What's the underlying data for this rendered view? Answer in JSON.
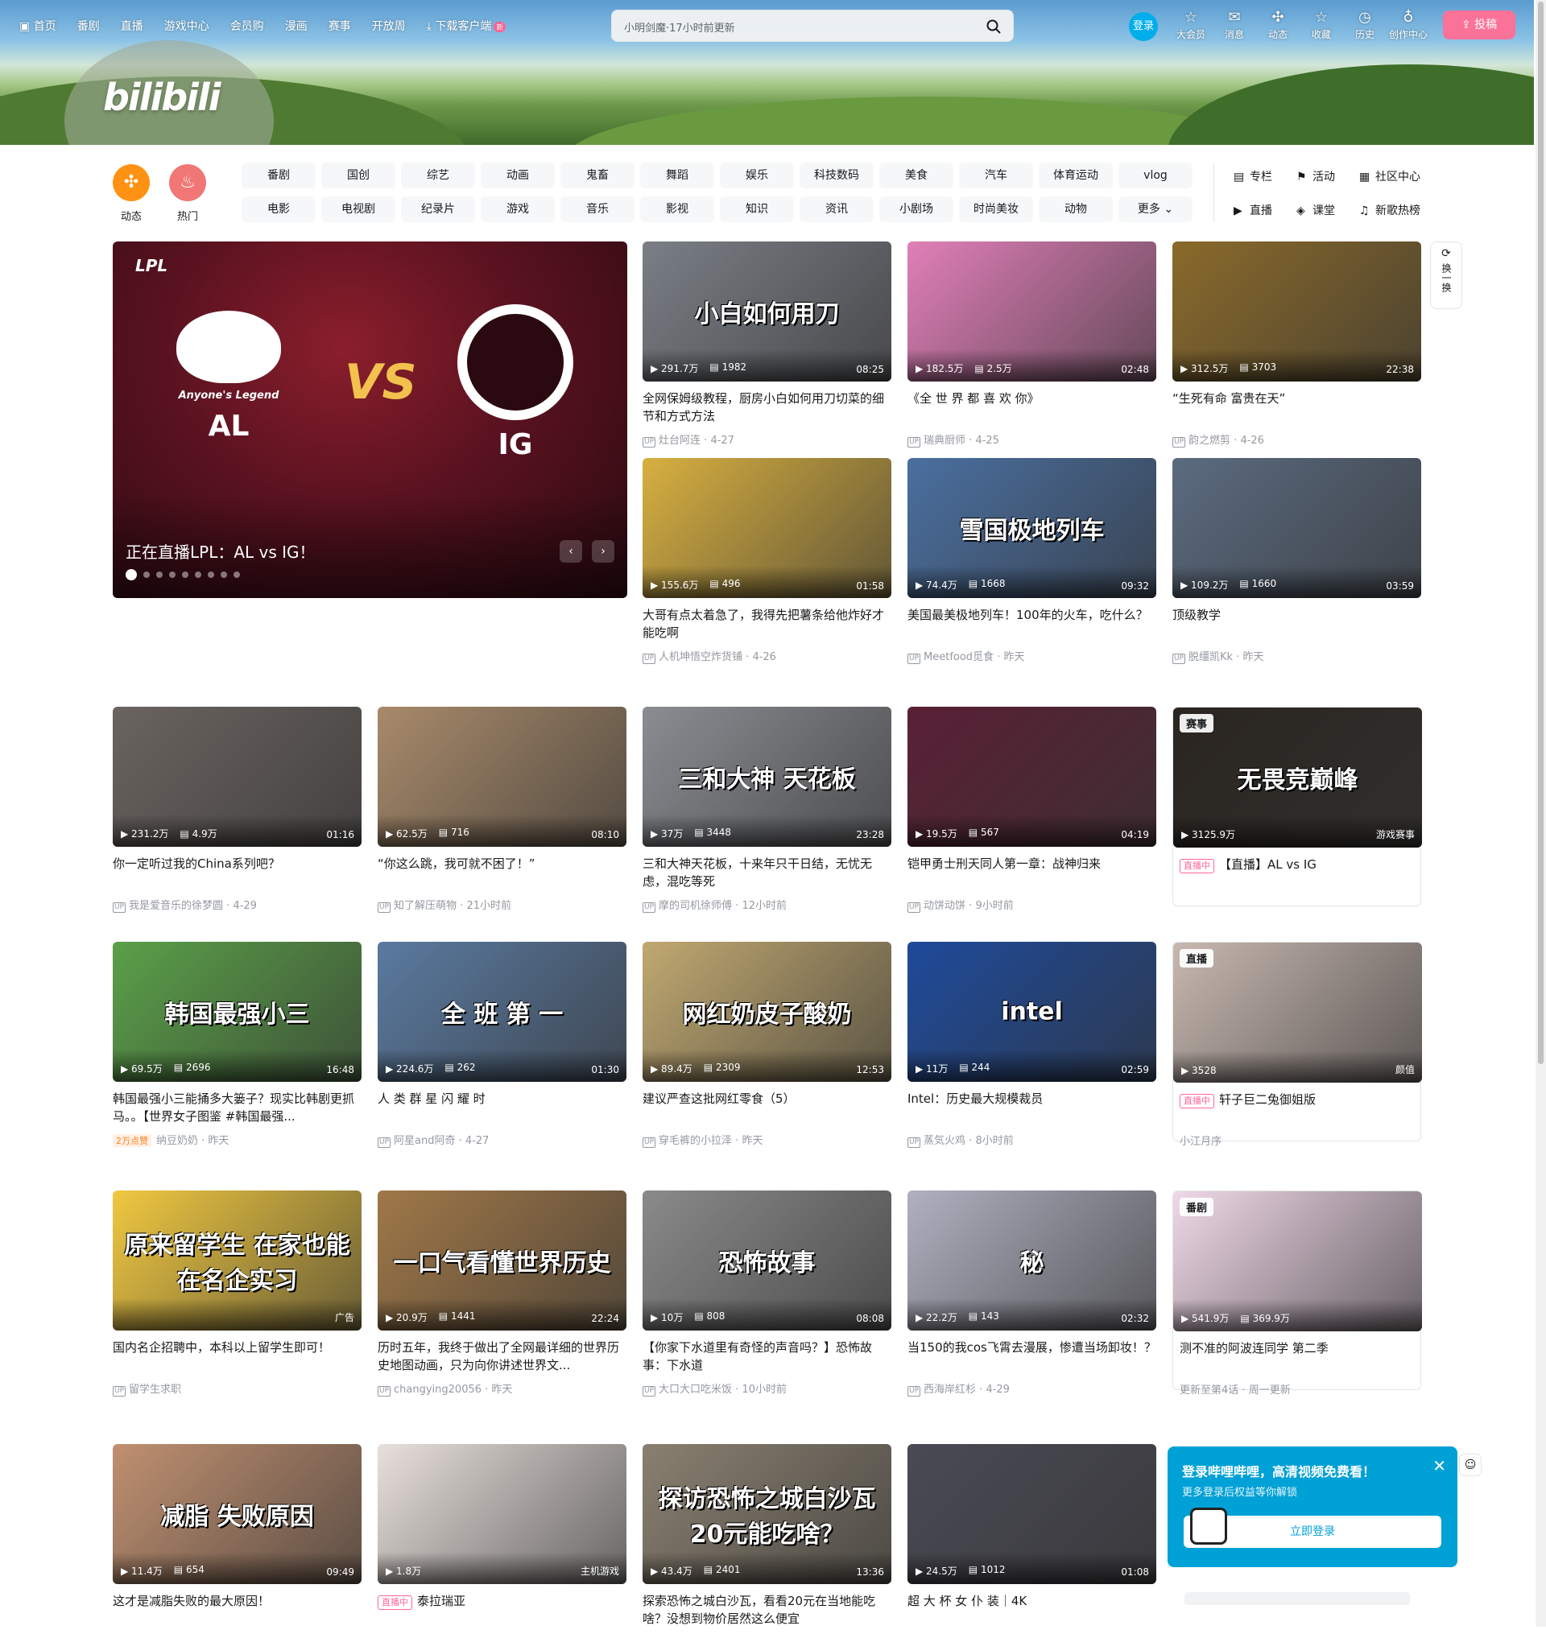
{
  "nav": {
    "items": [
      "首页",
      "番剧",
      "直播",
      "游戏中心",
      "会员购",
      "漫画",
      "赛事",
      "开放周"
    ],
    "download": "下载客户端",
    "download_badge": "新",
    "search_placeholder": "小明剑魔·17小时前更新",
    "login": "登录",
    "right_icons": [
      {
        "label": "大会员",
        "icon": "vip-icon"
      },
      {
        "label": "消息",
        "icon": "message-icon"
      },
      {
        "label": "动态",
        "icon": "dynamic-icon"
      },
      {
        "label": "收藏",
        "icon": "favorite-icon"
      },
      {
        "label": "历史",
        "icon": "history-icon"
      },
      {
        "label": "创作中心",
        "icon": "creator-icon"
      }
    ],
    "upload": "投稿",
    "logo": "bilibili"
  },
  "channels": {
    "dynamic": "动态",
    "hot": "热门",
    "row1": [
      "番剧",
      "国创",
      "综艺",
      "动画",
      "鬼畜",
      "舞蹈",
      "娱乐",
      "科技数码",
      "美食",
      "汽车",
      "体育运动",
      "vlog"
    ],
    "row2": [
      "电影",
      "电视剧",
      "纪录片",
      "游戏",
      "音乐",
      "影视",
      "知识",
      "资讯",
      "小剧场",
      "时尚美妆",
      "动物",
      "更多"
    ],
    "side": [
      "专栏",
      "活动",
      "社区中心",
      "直播",
      "课堂",
      "新歌热榜"
    ]
  },
  "hero": {
    "brand": "LPL",
    "team_left": "AL",
    "team_left_sub": "Anyone's Legend",
    "team_right": "IG",
    "vs": "VS",
    "title": "正在直播LPL：AL vs IG！"
  },
  "refresh": "换一换",
  "cards": [
    {
      "plays": "291.7万",
      "danmaku": "1982",
      "dur": "08:25",
      "cap": "小白如何用刀",
      "title": "全网保姆级教程，厨房小白如何用刀切菜的细节和方式方法",
      "author": "灶台阿连",
      "date": "4-27",
      "color": "#7a7f86"
    },
    {
      "plays": "182.5万",
      "danmaku": "2.5万",
      "dur": "02:48",
      "cap": "",
      "title": "《全 世 界 都 喜 欢 你》",
      "author": "瑞典厨师",
      "date": "4-25",
      "color": "#e07fb8"
    },
    {
      "plays": "312.5万",
      "danmaku": "3703",
      "dur": "22:38",
      "cap": "",
      "title": "“生死有命 富贵在天”",
      "author": "韵之燃剪",
      "date": "4-26",
      "color": "#8a6a2a"
    },
    {
      "plays": "155.6万",
      "danmaku": "496",
      "dur": "01:58",
      "cap": "",
      "title": "大哥有点太着急了，我得先把薯条给他炸好才能吃啊",
      "author": "人机坤悟空炸货铺",
      "date": "4-26",
      "color": "#d8b040"
    },
    {
      "plays": "74.4万",
      "danmaku": "1668",
      "dur": "09:32",
      "cap": "雪国极地列车",
      "title": "美国最美极地列车！100年的火车，吃什么？",
      "author": "Meetfood觅食",
      "date": "昨天",
      "color": "#4a6fa0"
    },
    {
      "plays": "109.2万",
      "danmaku": "1660",
      "dur": "03:59",
      "cap": "",
      "title": "顶级教学",
      "author": "脱缰凯Kk",
      "date": "昨天",
      "color": "#5b6b80"
    },
    {
      "plays": "231.2万",
      "danmaku": "4.9万",
      "dur": "01:16",
      "cap": "",
      "title": "你一定听过我的China系列吧？",
      "author": "我是爱音乐的徐梦圆",
      "date": "4-29",
      "color": "#6b6460"
    },
    {
      "plays": "62.5万",
      "danmaku": "716",
      "dur": "08:10",
      "cap": "",
      "title": "“你这么跳，我可就不困了！”",
      "author": "知了解压萌物",
      "date": "21小时前",
      "color": "#a88a6a"
    },
    {
      "plays": "37万",
      "danmaku": "3448",
      "dur": "23:28",
      "cap": "三和大神 天花板",
      "title": "三和大神天花板，十来年只干日结，无忧无虑，混吃等死",
      "author": "摩的司机徐师傅",
      "date": "12小时前",
      "color": "#8a8d92"
    },
    {
      "plays": "19.5万",
      "danmaku": "567",
      "dur": "04:19",
      "cap": "",
      "title": "铠甲勇士刑天同人第一章：战神归来",
      "author": "动饼动饼",
      "date": "9小时前",
      "color": "#5a2035"
    },
    {
      "plays": "3125.9万",
      "danmaku": "",
      "dur": "游戏赛事",
      "cap": "无畏竞巅峰",
      "title": "【直播】AL vs IG",
      "author": "",
      "date": "",
      "color": "#2a2520",
      "tag": "赛事",
      "live": "直播中"
    },
    {
      "plays": "69.5万",
      "danmaku": "2696",
      "dur": "16:48",
      "cap": "韩国最强小三",
      "title": "韩国最强小三能捅多大篓子？现实比韩剧更抓马。。【世界女子图鉴 #韩国最强...",
      "author": "纳豆奶奶",
      "date": "昨天",
      "color": "#5aa048",
      "like": "2万点赞"
    },
    {
      "plays": "224.6万",
      "danmaku": "262",
      "dur": "01:30",
      "cap": "全 班 第 一",
      "title": "人 类 群 星 闪 耀 时",
      "author": "阿星and阿奇",
      "date": "4-27",
      "color": "#5a7aa0"
    },
    {
      "plays": "89.4万",
      "danmaku": "2309",
      "dur": "12:53",
      "cap": "网红奶皮子酸奶",
      "title": "建议严查这批网红零食（5）",
      "author": "穿毛裤的小拉泽",
      "date": "昨天",
      "color": "#c0a870"
    },
    {
      "plays": "11万",
      "danmaku": "244",
      "dur": "02:59",
      "cap": "intel",
      "title": "Intel：历史最大规模裁员",
      "author": "蒸気火鸡",
      "date": "8小时前",
      "color": "#1e4a9a"
    },
    {
      "plays": "3528",
      "danmaku": "",
      "dur": "颜值",
      "cap": "",
      "title": "轩子巨二兔御姐版",
      "author": "小江月序",
      "date": "",
      "color": "#c8b8b0",
      "tag": "直播",
      "live": "直播中"
    },
    {
      "plays": "",
      "danmaku": "",
      "dur": "广告",
      "cap": "原来留学生 在家也能在名企实习",
      "title": "国内名企招聘中，本科以上留学生即可！",
      "author": "留学生求职",
      "date": "",
      "color": "#f0c840"
    },
    {
      "plays": "20.9万",
      "danmaku": "1441",
      "dur": "22:24",
      "cap": "一口气看懂世界历史",
      "title": "历时五年，我终于做出了全网最详细的世界历史地图动画，只为向你讲述世界文...",
      "author": "changying20056",
      "date": "昨天",
      "color": "#a07848"
    },
    {
      "plays": "10万",
      "danmaku": "808",
      "dur": "08:08",
      "cap": "恐怖故事",
      "title": "【你家下水道里有奇怪的声音吗？】恐怖故事：下水道",
      "author": "大口大口吃米饭",
      "date": "10小时前",
      "color": "#8a8a8a"
    },
    {
      "plays": "22.2万",
      "danmaku": "143",
      "dur": "02:32",
      "cap": "秘",
      "title": "当150的我cos飞霄去漫展，惨遭当场卸妆！？",
      "author": "西海岸红杉",
      "date": "4-29",
      "color": "#b0b0c0"
    },
    {
      "plays": "541.9万",
      "danmaku": "369.9万",
      "dur": "",
      "cap": "",
      "title": "测不准的阿波连同学 第二季",
      "author": "更新至第4话",
      "date": "周一更新",
      "color": "#f0d8e8",
      "tag": "番剧"
    },
    {
      "plays": "11.4万",
      "danmaku": "654",
      "dur": "09:49",
      "cap": "减脂 失败原因",
      "title": "这才是减脂失败的最大原因！",
      "author": "",
      "date": "",
      "color": "#c09070"
    },
    {
      "plays": "1.8万",
      "danmaku": "",
      "dur": "主机游戏",
      "cap": "",
      "title": "泰拉瑞亚",
      "author": "",
      "date": "",
      "color": "#e8e0dc",
      "live": "直播中"
    },
    {
      "plays": "43.4万",
      "danmaku": "2401",
      "dur": "13:36",
      "cap": "探访恐怖之城白沙瓦 20元能吃啥？",
      "title": "探索恐怖之城白沙瓦，看看20元在当地能吃啥？没想到物价居然这么便宜",
      "author": "",
      "date": "",
      "color": "#8a8070"
    },
    {
      "plays": "24.5万",
      "danmaku": "1012",
      "dur": "01:08",
      "cap": "",
      "title": "超 大 杯 女 仆 装｜4K",
      "author": "",
      "date": "",
      "color": "#4a4a55"
    }
  ],
  "popup": {
    "title": "登录哔哩哔哩，高清视频免费看！",
    "subtitle": "更多登录后权益等你解锁",
    "button": "立即登录"
  }
}
